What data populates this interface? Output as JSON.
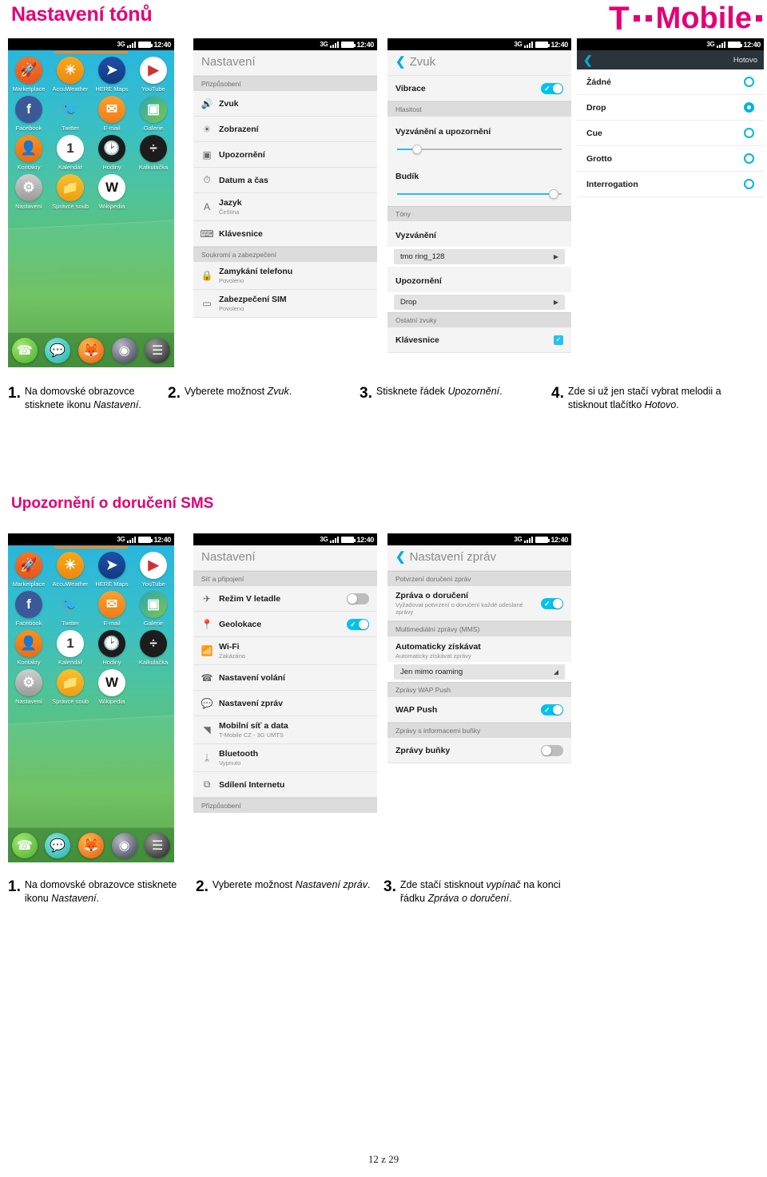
{
  "page": {
    "title": "Nastavení tónů",
    "section2_title": "Upozornění o doručení SMS",
    "footer": "12 z 29",
    "brand": {
      "letter": "T",
      "word": "Mobile",
      "color": "#e20074"
    }
  },
  "statusbar": {
    "network": "3G",
    "time": "12:40"
  },
  "homescreen": {
    "apps": [
      {
        "label": "Marketplace",
        "icon": "marketplace-icon",
        "glyph": "🚀",
        "bg": "linear-gradient(180deg,#f0772a,#e8551d)"
      },
      {
        "label": "AccuWeather",
        "icon": "accuweather-icon",
        "glyph": "☀",
        "bg": "linear-gradient(180deg,#f7a81b,#f0870f)"
      },
      {
        "label": "HERE Maps",
        "icon": "here-maps-icon",
        "glyph": "➤",
        "bg": "linear-gradient(180deg,#1f4fa8,#123a80)"
      },
      {
        "label": "YouTube",
        "icon": "youtube-icon",
        "glyph": "▶",
        "bg": "#ffffff"
      },
      {
        "label": "Facebook",
        "icon": "facebook-icon",
        "glyph": "f",
        "bg": "#3b5998"
      },
      {
        "label": "Twitter",
        "icon": "twitter-icon",
        "glyph": "🐦",
        "bg": "transparent"
      },
      {
        "label": "E-mail",
        "icon": "email-icon",
        "glyph": "✉",
        "bg": "linear-gradient(180deg,#f8a030,#ef7d16)"
      },
      {
        "label": "Galerie",
        "icon": "gallery-icon",
        "glyph": "▣",
        "bg": "linear-gradient(135deg,#2aa7b5,#7ec44a)"
      },
      {
        "label": "Kontakty",
        "icon": "contacts-icon",
        "glyph": "👤",
        "bg": "linear-gradient(180deg,#f7921e,#ef6c12)"
      },
      {
        "label": "Kalendář",
        "icon": "calendar-icon",
        "glyph": "1",
        "bg": "#ffffff"
      },
      {
        "label": "Hodiny",
        "icon": "clock-icon",
        "glyph": "🕑",
        "bg": "#1c1c1c"
      },
      {
        "label": "Kalkulačka",
        "icon": "calculator-icon",
        "glyph": "÷",
        "bg": "#1c1c1c"
      },
      {
        "label": "Nastavení",
        "icon": "settings-icon",
        "glyph": "⚙",
        "bg": "linear-gradient(180deg,#cfcfcf,#9a9a9a)"
      },
      {
        "label": "Správce soub",
        "icon": "file-manager-icon",
        "glyph": "📁",
        "bg": "linear-gradient(180deg,#f7c02e,#ef9f14)"
      },
      {
        "label": "Wikipedia",
        "icon": "wikipedia-icon",
        "glyph": "W",
        "bg": "#ffffff"
      }
    ],
    "dock": [
      {
        "icon": "phone-icon",
        "glyph": "☎",
        "bg": "radial-gradient(circle at 35% 30%,#9fe870,#4cae2e)"
      },
      {
        "icon": "messages-icon",
        "glyph": "💬",
        "bg": "radial-gradient(circle at 35% 30%,#7fe3da,#26b3b0)"
      },
      {
        "icon": "firefox-browser-icon",
        "glyph": "🦊",
        "bg": "radial-gradient(circle at 35% 30%,#ffb74d,#e8590c)"
      },
      {
        "icon": "camera-icon",
        "glyph": "◉",
        "bg": "radial-gradient(circle at 35% 30%,#b9b9c6,#3b3b52)"
      },
      {
        "icon": "music-icon",
        "glyph": "☰",
        "bg": "radial-gradient(circle at 35% 30%,#9a9a9a,#1d1d1d)"
      }
    ]
  },
  "settings_sound_list": {
    "header": "Nastavení",
    "groups": [
      {
        "label": "Přizpůsobení",
        "rows": [
          {
            "title": "Zvuk",
            "sub": "",
            "icon": "speaker-icon",
            "glyph": "🔊"
          },
          {
            "title": "Zobrazení",
            "sub": "",
            "icon": "brightness-icon",
            "glyph": "☀"
          },
          {
            "title": "Upozornění",
            "sub": "",
            "icon": "notification-icon",
            "glyph": "▣"
          },
          {
            "title": "Datum a čas",
            "sub": "",
            "icon": "clock-icon",
            "glyph": "⏱"
          },
          {
            "title": "Jazyk",
            "sub": "Čeština",
            "icon": "language-icon",
            "glyph": "A"
          },
          {
            "title": "Klávesnice",
            "sub": "",
            "icon": "keyboard-icon",
            "glyph": "⌨"
          }
        ]
      },
      {
        "label": "Soukromí a zabezpečení",
        "rows": [
          {
            "title": "Zamykání telefonu",
            "sub": "Povoleno",
            "icon": "lock-icon",
            "glyph": "🔒"
          },
          {
            "title": "Zabezpečení SIM",
            "sub": "Povoleno",
            "icon": "sim-card-icon",
            "glyph": "▭"
          }
        ]
      }
    ]
  },
  "sound_screen": {
    "header": "Zvuk",
    "vibration": {
      "label": "Vibrace",
      "state": "on"
    },
    "volume_group": "Hlasitost",
    "sliders": [
      {
        "label": "Vyzvánění a upozornění",
        "value": 12
      },
      {
        "label": "Budík",
        "value": 95
      }
    ],
    "tones_group": "Tóny",
    "tones": [
      {
        "label": "Vyzvánění",
        "value": "tmo ring_128"
      },
      {
        "label": "Upozornění",
        "value": "Drop"
      }
    ],
    "other_group": "Ostatní zvuky",
    "keyboard": {
      "label": "Klávesnice",
      "checked": true
    }
  },
  "tone_picker": {
    "done_label": "Hotovo",
    "options": [
      {
        "label": "Žádné",
        "selected": false
      },
      {
        "label": "Drop",
        "selected": true
      },
      {
        "label": "Cue",
        "selected": false
      },
      {
        "label": "Grotto",
        "selected": false
      },
      {
        "label": "Interrogation",
        "selected": false
      }
    ]
  },
  "settings_network_list": {
    "header": "Nastavení",
    "group_label": "Síť a připojení",
    "rows": [
      {
        "title": "Režim V letadle",
        "sub": "",
        "icon": "airplane-icon",
        "glyph": "✈",
        "control": "toggle-off"
      },
      {
        "title": "Geolokace",
        "sub": "",
        "icon": "location-pin-icon",
        "glyph": "📍",
        "control": "toggle-on"
      },
      {
        "title": "Wi-Fi",
        "sub": "Zakázáno",
        "icon": "wifi-icon",
        "glyph": "📶",
        "control": "none"
      },
      {
        "title": "Nastavení volání",
        "sub": "",
        "icon": "phone-handset-icon",
        "glyph": "☎",
        "control": "none"
      },
      {
        "title": "Nastavení zpráv",
        "sub": "",
        "icon": "message-bubble-icon",
        "glyph": "💬",
        "control": "none"
      },
      {
        "title": "Mobilní síť a data",
        "sub": "T-Mobile CZ - 3G UMTS",
        "icon": "signal-bars-icon",
        "glyph": "◥",
        "control": "none"
      },
      {
        "title": "Bluetooth",
        "sub": "Vypnuto",
        "icon": "bluetooth-icon",
        "glyph": "ᛦ",
        "control": "none"
      },
      {
        "title": "Sdílení Internetu",
        "sub": "",
        "icon": "tethering-icon",
        "glyph": "⧉",
        "control": "none"
      }
    ],
    "footer_group": "Přizpůsobení"
  },
  "message_settings": {
    "header": "Nastavení zpráv",
    "group1": "Potvrzení doručení zpráv",
    "delivery": {
      "title": "Zpráva o doručení",
      "sub": "Vyžadovat potvrzení o doručení každé odeslané zprávy",
      "state": "on"
    },
    "group2": "Multimediální zprávy (MMS)",
    "auto": {
      "title": "Automaticky získávat",
      "sub": "Automaticky získávat zprávy",
      "value": "Jen mimo roaming"
    },
    "group3": "Zprávy WAP Push",
    "wap": {
      "title": "WAP Push",
      "state": "on"
    },
    "group4": "Zprávy s informacemi buňky",
    "cell": {
      "title": "Zprávy buňky",
      "state": "off"
    }
  },
  "steps_top": [
    {
      "num": "1.",
      "parts": [
        "Na domovské obrazovce stisknete ikonu ",
        "Nastavení",
        "."
      ]
    },
    {
      "num": "2.",
      "parts": [
        "Vyberete možnost ",
        "Zvuk",
        "."
      ]
    },
    {
      "num": "3.",
      "parts": [
        "Stisknete řádek ",
        "Upozornění",
        "."
      ]
    },
    {
      "num": "4.",
      "parts": [
        "Zde si už jen stačí vybrat melodii a stisknout tlačítko ",
        "Hotovo",
        "."
      ]
    }
  ],
  "steps_bottom": [
    {
      "num": "1.",
      "parts": [
        "Na domovské obrazovce stisknete ikonu ",
        "Nastavení",
        "."
      ]
    },
    {
      "num": "2.",
      "parts": [
        "Vyberete možnost ",
        "Nastavení zpráv",
        "."
      ]
    },
    {
      "num": "3.",
      "parts": [
        "Zde stačí stisknout ",
        "vypínač",
        " na konci řádku ",
        "Zpráva o doručení",
        "."
      ]
    }
  ]
}
